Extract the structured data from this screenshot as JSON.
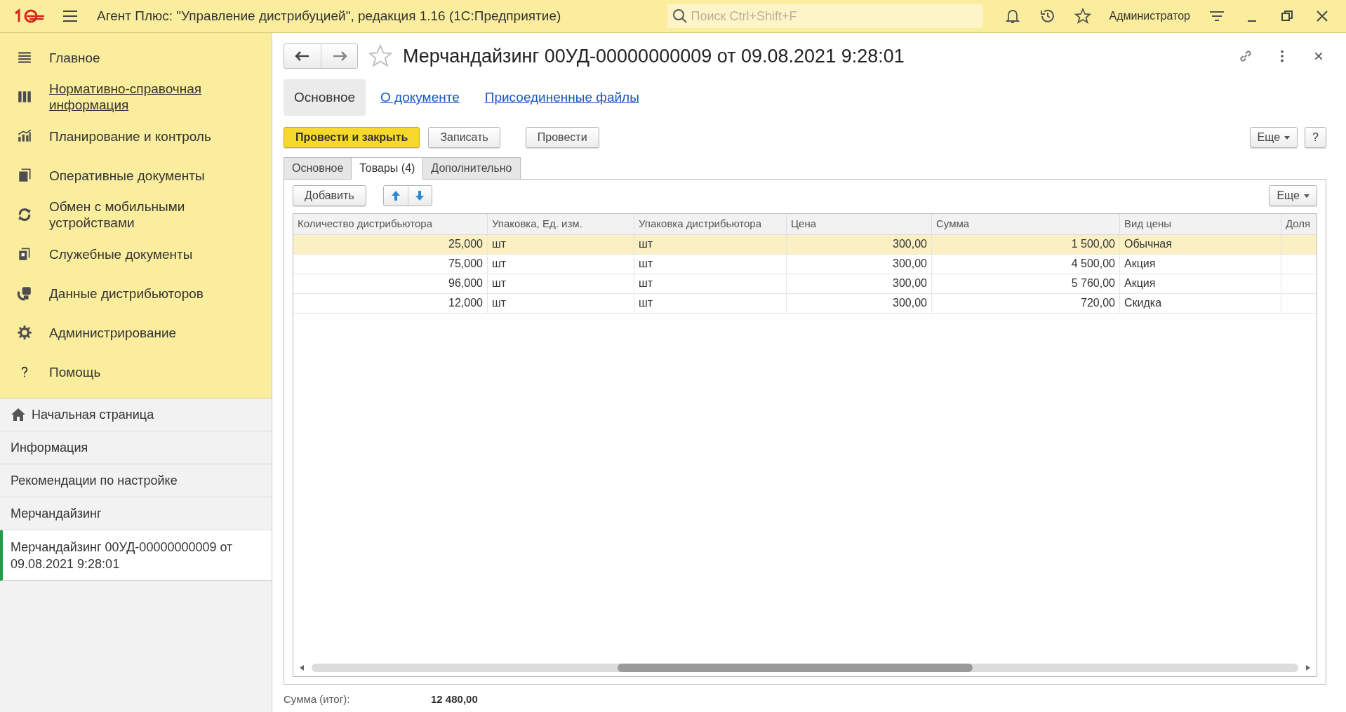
{
  "title_bar": {
    "app_title": "Агент Плюс: \"Управление дистрибуцией\", редакция 1.16  (1С:Предприятие)",
    "search": {
      "placeholder": "Поиск Ctrl+Shift+F"
    },
    "user": "Администратор"
  },
  "sidebar": {
    "sections": [
      {
        "label": "Главное",
        "hovered": false
      },
      {
        "label": "Нормативно-справочная информация",
        "hovered": true
      },
      {
        "label": "Планирование и контроль",
        "hovered": false
      },
      {
        "label": "Оперативные документы",
        "hovered": false
      },
      {
        "label": "Обмен с мобильными устройствами",
        "hovered": false
      },
      {
        "label": "Служебные документы",
        "hovered": false
      },
      {
        "label": "Данные дистрибьюторов",
        "hovered": false
      },
      {
        "label": "Администрирование",
        "hovered": false
      },
      {
        "label": "Помощь",
        "hovered": false
      }
    ],
    "open_windows": [
      {
        "label": "Начальная страница",
        "kind": "home",
        "selected": false
      },
      {
        "label": "Информация",
        "kind": "page",
        "selected": false
      },
      {
        "label": "Рекомендации по настройке",
        "kind": "page",
        "selected": false
      },
      {
        "label": "Мерчандайзинг",
        "kind": "page",
        "selected": false
      },
      {
        "label": "Мерчандайзинг 00УД-00000000009 от 09.08.2021 9:28:01",
        "kind": "page",
        "selected": true
      }
    ]
  },
  "document": {
    "title": "Мерчандайзинг 00УД-00000000009 от 09.08.2021 9:28:01",
    "nav": [
      {
        "label": "Основное",
        "selected": true
      },
      {
        "label": "О документе",
        "selected": false
      },
      {
        "label": "Присоединенные файлы",
        "selected": false
      }
    ],
    "buttons": [
      {
        "label": "Провести и закрыть",
        "kind": "primary"
      },
      {
        "label": "Записать",
        "kind": "normal"
      },
      {
        "label": "Провести",
        "kind": "normal"
      }
    ],
    "more_button": "Еще",
    "help_button": "?",
    "tabs": [
      {
        "label": "Основное",
        "selected": false
      },
      {
        "label": "Товары (4)",
        "selected": true
      },
      {
        "label": "Дополнительно",
        "selected": false
      }
    ],
    "table_toolbar": {
      "add_button": "Добавить",
      "more_button": "Еще"
    },
    "table": {
      "columns": [
        {
          "label": "Количество дистрибьютора"
        },
        {
          "label": "Упаковка, Ед. изм."
        },
        {
          "label": "Упаковка дистрибьютора"
        },
        {
          "label": "Цена"
        },
        {
          "label": "Сумма"
        },
        {
          "label": "Вид цены"
        },
        {
          "label": "Доля"
        }
      ],
      "rows": [
        {
          "cells": [
            "25,000",
            "шт",
            "шт",
            "300,00",
            "1 500,00",
            "Обычная",
            ""
          ],
          "selected": true
        },
        {
          "cells": [
            "75,000",
            "шт",
            "шт",
            "300,00",
            "4 500,00",
            "Акция",
            ""
          ],
          "selected": false
        },
        {
          "cells": [
            "96,000",
            "шт",
            "шт",
            "300,00",
            "5 760,00",
            "Акция",
            ""
          ],
          "selected": false
        },
        {
          "cells": [
            "12,000",
            "шт",
            "шт",
            "300,00",
            "720,00",
            "Скидка",
            ""
          ],
          "selected": false
        }
      ]
    },
    "total": {
      "label": "Сумма (итог):",
      "value": "12 480,00"
    }
  }
}
